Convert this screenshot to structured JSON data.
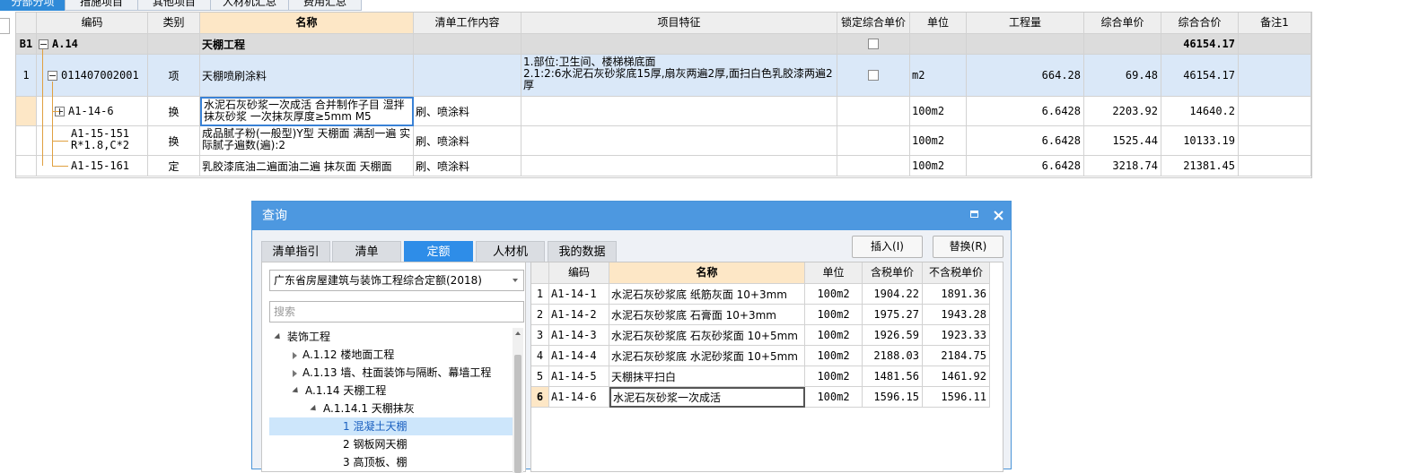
{
  "top_tabs": [
    {
      "label": "分部分项",
      "active": true
    },
    {
      "label": "措施项目",
      "active": false
    },
    {
      "label": "其他项目",
      "active": false
    },
    {
      "label": "人材机汇总",
      "active": false
    },
    {
      "label": "费用汇总",
      "active": false
    }
  ],
  "main_table": {
    "columns": [
      "编码",
      "类别",
      "名称",
      "清单工作内容",
      "项目特征",
      "锁定综合单价",
      "单位",
      "工程量",
      "综合单价",
      "综合合价",
      "备注1"
    ],
    "rows": [
      {
        "num": "B1",
        "code": "A.14",
        "type": "",
        "name": "天棚工程",
        "work": "",
        "feature": "",
        "lock": true,
        "unit": "",
        "qty": "",
        "price": "",
        "total": "46154.17",
        "note": ""
      },
      {
        "num": "1",
        "code": "011407002001",
        "type": "项",
        "name": "天棚喷刷涂料",
        "work": "",
        "feature": "1.部位:卫生间、楼梯梯底面\n2.1:2:6水泥石灰砂浆底15厚,扇灰两遍2厚,面扫白色乳胶漆两遍2厚",
        "lock": true,
        "unit": "m2",
        "qty": "664.28",
        "price": "69.48",
        "total": "46154.17",
        "note": ""
      },
      {
        "num": "",
        "code": "A1-14-6",
        "type": "换",
        "name": "水泥石灰砂浆一次成活  合并制作子目 湿拌抹灰砂浆 一次抹灰厚度≥5mm M5",
        "work": "刷、喷涂料",
        "feature": "",
        "lock": false,
        "unit": "100m2",
        "qty": "6.6428",
        "price": "2203.92",
        "total": "14640.2",
        "note": ""
      },
      {
        "num": "",
        "code": "A1-15-151\nR*1.8,C*2",
        "type": "换",
        "name": "成品腻子粉(一般型)Y型 天棚面 满刮一遍 实际腻子遍数(遍):2",
        "work": "刷、喷涂料",
        "feature": "",
        "lock": false,
        "unit": "100m2",
        "qty": "6.6428",
        "price": "1525.44",
        "total": "10133.19",
        "note": ""
      },
      {
        "num": "",
        "code": "A1-15-161",
        "type": "定",
        "name": "乳胶漆底油二遍面油二遍 抹灰面 天棚面",
        "work": "刷、喷涂料",
        "feature": "",
        "lock": false,
        "unit": "100m2",
        "qty": "6.6428",
        "price": "3218.74",
        "total": "21381.45",
        "note": ""
      }
    ]
  },
  "dialog": {
    "title": "查询",
    "tabs": [
      {
        "label": "清单指引",
        "active": false
      },
      {
        "label": "清单",
        "active": false
      },
      {
        "label": "定额",
        "active": true
      },
      {
        "label": "人材机",
        "active": false
      },
      {
        "label": "我的数据",
        "active": false
      }
    ],
    "insert_label": "插入(I)",
    "replace_label": "替换(R)",
    "library_select": "广东省房屋建筑与装饰工程综合定额(2018)",
    "search_placeholder": "搜索",
    "tree": [
      {
        "label": "装饰工程",
        "state": "open",
        "level": 0
      },
      {
        "label": "A.1.12 楼地面工程",
        "state": "closed",
        "level": 1
      },
      {
        "label": "A.1.13 墙、柱面装饰与隔断、幕墙工程",
        "state": "closed",
        "level": 1
      },
      {
        "label": "A.1.14 天棚工程",
        "state": "open",
        "level": 1
      },
      {
        "label": "A.1.14.1 天棚抹灰",
        "state": "open",
        "level": 2
      },
      {
        "label": "1 混凝土天棚",
        "state": "leaf",
        "level": 3,
        "selected": true
      },
      {
        "label": "2 钢板网天棚",
        "state": "leaf",
        "level": 3
      },
      {
        "label": "3 高顶板、棚",
        "state": "leaf",
        "level": 3
      }
    ],
    "result_columns": [
      "编码",
      "名称",
      "单位",
      "含税单价",
      "不含税单价"
    ],
    "results": [
      {
        "num": "1",
        "code": "A1-14-1",
        "name": "水泥石灰砂浆底 纸筋灰面 10+3mm",
        "unit": "100m2",
        "tax": "1904.22",
        "notax": "1891.36"
      },
      {
        "num": "2",
        "code": "A1-14-2",
        "name": "水泥石灰砂浆底 石膏面 10+3mm",
        "unit": "100m2",
        "tax": "1975.27",
        "notax": "1943.28"
      },
      {
        "num": "3",
        "code": "A1-14-3",
        "name": "水泥石灰砂浆底 石灰砂浆面 10+5mm",
        "unit": "100m2",
        "tax": "1926.59",
        "notax": "1923.33"
      },
      {
        "num": "4",
        "code": "A1-14-4",
        "name": "水泥石灰砂浆底 水泥砂浆面 10+5mm",
        "unit": "100m2",
        "tax": "2188.03",
        "notax": "2184.75"
      },
      {
        "num": "5",
        "code": "A1-14-5",
        "name": "天棚抹平扫白",
        "unit": "100m2",
        "tax": "1481.56",
        "notax": "1461.92"
      },
      {
        "num": "6",
        "code": "A1-14-6",
        "name": "水泥石灰砂浆一次成活",
        "unit": "100m2",
        "tax": "1596.15",
        "notax": "1596.11"
      }
    ]
  }
}
